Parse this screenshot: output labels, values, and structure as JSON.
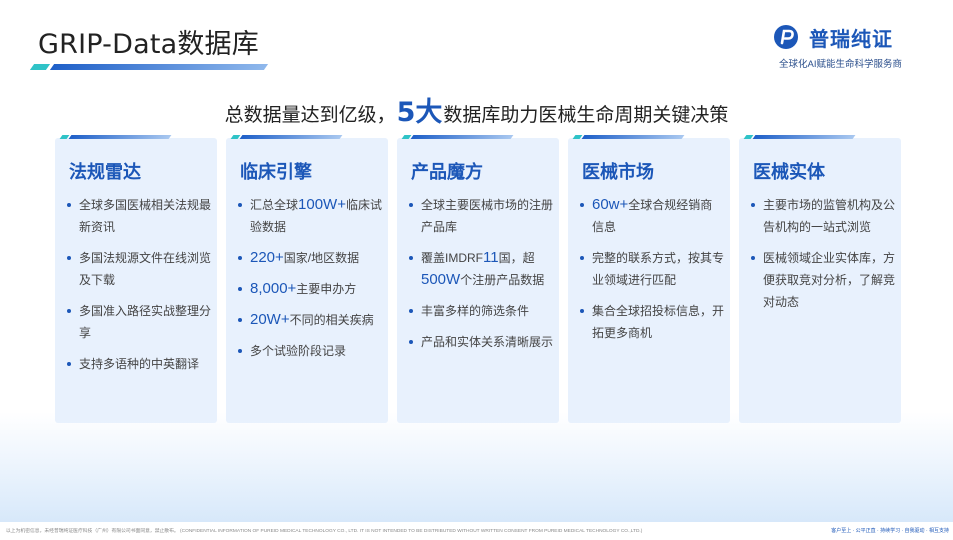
{
  "title": "GRIP-Data数据库",
  "logo": {
    "name": "普瑞纯证",
    "tagline": "全球化AI赋能生命科学服务商"
  },
  "headline": {
    "prefix": "总数据量达到亿级，",
    "big": "5大",
    "suffix": "数据库助力医械生命周期关键决策"
  },
  "cards": [
    {
      "title": "法规雷达",
      "items": [
        {
          "em": "",
          "text": "全球多国医械相关法规最新资讯"
        },
        {
          "em": "",
          "text": "多国法规源文件在线浏览及下载"
        },
        {
          "em": "",
          "text": "多国准入路径实战整理分享"
        },
        {
          "em": "",
          "text": "支持多语种的中英翻译"
        }
      ]
    },
    {
      "title": "临床引擎",
      "items": [
        {
          "em": "",
          "pre": "汇总全球",
          "num": "100W+",
          "text": "临床试验数据"
        },
        {
          "em": "220+",
          "text": "国家/地区数据"
        },
        {
          "em": "8,000+",
          "text": "主要申办方"
        },
        {
          "em": "20W+",
          "text": "不同的相关疾病"
        },
        {
          "em": "",
          "text": "多个试验阶段记录"
        }
      ]
    },
    {
      "title": "产品魔方",
      "items": [
        {
          "em": "",
          "text": "全球主要医械市场的注册产品库"
        },
        {
          "em": "",
          "pre": "覆盖IMDRF",
          "num": "11",
          "text": "国，超",
          "tail_em": "500W",
          "tail": "个注册产品数据"
        },
        {
          "em": "",
          "text": "丰富多样的筛选条件"
        },
        {
          "em": "",
          "text": "产品和实体关系清晰展示"
        }
      ]
    },
    {
      "title": "医械市场",
      "items": [
        {
          "em": "60w+",
          "text": "全球合规经销商信息"
        },
        {
          "em": "",
          "text": "完整的联系方式，按其专业领域进行匹配"
        },
        {
          "em": "",
          "text": "集合全球招投标信息，开拓更多商机"
        }
      ]
    },
    {
      "title": "医械实体",
      "items": [
        {
          "em": "",
          "text": "主要市场的监管机构及公告机构的一站式浏览"
        },
        {
          "em": "",
          "text": "医械领域企业实体库，方便获取竞对分析，了解竞对动态"
        }
      ]
    }
  ],
  "footer": {
    "left": "以上为机密信息，未经普瑞纯证医疗科技（广州）有限公司书面同意，禁止散布。 (CONFIDENTIAL INFORMATION OF PUREID MEDICAL TECHNOLOGY CO., LTD. IT IS NOT INTENDED TO BE DISTRIBUTED WITHOUT WRITTEN CONSENT FROM PUREID MEDICAL TECHNOLOGY CO.,LTD.)",
    "right": "客户至上 · 公平正直 · 持续学习 · 自我驱动 · 相互支持"
  },
  "colors": {
    "brand": "#1c57b8",
    "accent_teal": "#2fc3c7",
    "card_bg": "#e8f1fd"
  }
}
